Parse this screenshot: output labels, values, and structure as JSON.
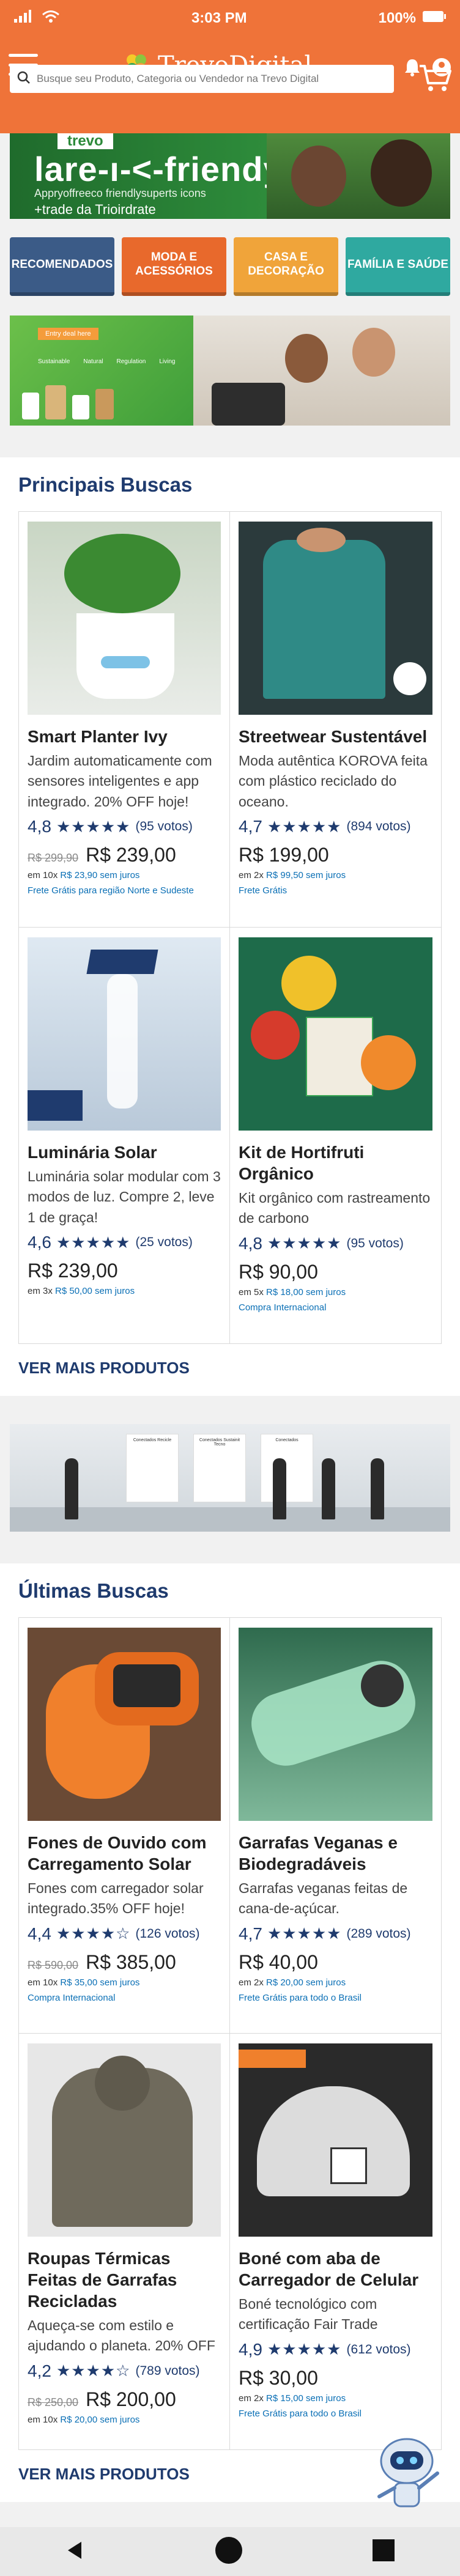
{
  "status": {
    "time": "3:03 PM",
    "battery": "100%"
  },
  "header": {
    "brand": "TrevoDigital",
    "search_placeholder": "Busque seu Produto, Categoria ou Vendedor na Trevo Digital"
  },
  "hero": {
    "tag": "trevo",
    "headline": "lare-ı-<-friendy",
    "subline": "Appryoffreeco friendlysuperts icons",
    "subline2": "+trade da Trioirdrate"
  },
  "categories": [
    {
      "label": "RECOMENDADOS",
      "color": "#3b5b87"
    },
    {
      "label": "MODA E ACESSÓRIOS",
      "color": "#e8692c"
    },
    {
      "label": "CASA E DECORAÇÃO",
      "color": "#f0a43a"
    },
    {
      "label": "FAMÍLIA E SAÚDE",
      "color": "#2fa9a0"
    }
  ],
  "promo": {
    "pill": "Entry deal here",
    "nav": [
      "Sustainable",
      "Natural",
      "Regulation",
      "Living"
    ]
  },
  "section1": {
    "title": "Principais Buscas",
    "more": "VER MAIS PRODUTOS",
    "products": [
      {
        "title": "Smart Planter Ivy",
        "desc": "Jardim automaticamente com sensores inteligentes e app integrado. 20% OFF hoje!",
        "rating": "4,8",
        "stars": 5.0,
        "votes": "(95 votos)",
        "old": "R$ 299,90",
        "price": "R$ 239,00",
        "inst_prefix": "em 10x ",
        "inst_amount": "R$ 23,90 sem juros",
        "ship": "Frete Grátis para região Norte e Sudeste"
      },
      {
        "title": "Streetwear Sustentável",
        "desc": "Moda autêntica KOROVA feita com plástico reciclado do oceano.",
        "rating": "4,7",
        "stars": 5.0,
        "votes": "(894 votos)",
        "old": "",
        "price": "R$ 199,00",
        "inst_prefix": "em 2x ",
        "inst_amount": "R$ 99,50 sem juros",
        "ship": "Frete Grátis"
      },
      {
        "title": "Luminária Solar",
        "desc": "Luminária solar modular com 3 modos de luz. Compre 2, leve 1 de graça!",
        "rating": "4,6",
        "stars": 5.0,
        "votes": "(25 votos)",
        "old": "",
        "price": "R$ 239,00",
        "inst_prefix": "em 3x ",
        "inst_amount": "R$ 50,00 sem juros",
        "ship": ""
      },
      {
        "title": "Kit de Hortifruti Orgânico",
        "desc": "Kit orgânico com rastreamento de carbono",
        "rating": "4,8",
        "stars": 5.0,
        "votes": "(95 votos)",
        "old": "",
        "price": "R$ 90,00",
        "inst_prefix": "em 5x ",
        "inst_amount": "R$ 18,00 sem juros",
        "ship": "Compra Internacional"
      }
    ]
  },
  "showroom": {
    "panels": [
      "Conectados Recicle",
      "Conectados Sustainit Tecno",
      "Conectados"
    ]
  },
  "section2": {
    "title": "Últimas Buscas",
    "more": "VER MAIS PRODUTOS",
    "products": [
      {
        "title": "Fones de Ouvido com Carregamento Solar",
        "desc": "Fones com carregador solar integrado.35% OFF hoje!",
        "rating": "4,4",
        "stars": 4.5,
        "votes": "(126 votos)",
        "old": "R$ 590,00",
        "price": "R$ 385,00",
        "inst_prefix": "em 10x ",
        "inst_amount": "R$ 35,00 sem juros",
        "ship": "Compra Internacional"
      },
      {
        "title": "Garrafas Veganas e Biodegradáveis",
        "desc": "Garrafas veganas feitas de cana-de-açúcar.",
        "rating": "4,7",
        "stars": 5.0,
        "votes": "(289 votos)",
        "old": "",
        "price": "R$ 40,00",
        "inst_prefix": "em 2x ",
        "inst_amount": "R$ 20,00 sem juros",
        "ship": "Frete Grátis para todo o Brasil"
      },
      {
        "title": "Roupas Térmicas Feitas de Garrafas Recicladas",
        "desc": "Aqueça-se com estilo e ajudando o planeta. 20% OFF",
        "rating": "4,2",
        "stars": 4.0,
        "votes": "(789 votos)",
        "old": "R$ 250,00",
        "price": "R$ 200,00",
        "inst_prefix": "em 10x ",
        "inst_amount": "R$ 20,00 sem juros",
        "ship": ""
      },
      {
        "title": "Boné com aba de Carregador de Celular",
        "desc": "Boné tecnológico com certificação Fair Trade",
        "rating": "4,9",
        "stars": 5.0,
        "votes": "(612 votos)",
        "old": "",
        "price": "R$ 30,00",
        "inst_prefix": "em 2x ",
        "inst_amount": "R$ 15,00 sem juros",
        "ship": "Frete Grátis para todo o Brasil"
      }
    ]
  }
}
